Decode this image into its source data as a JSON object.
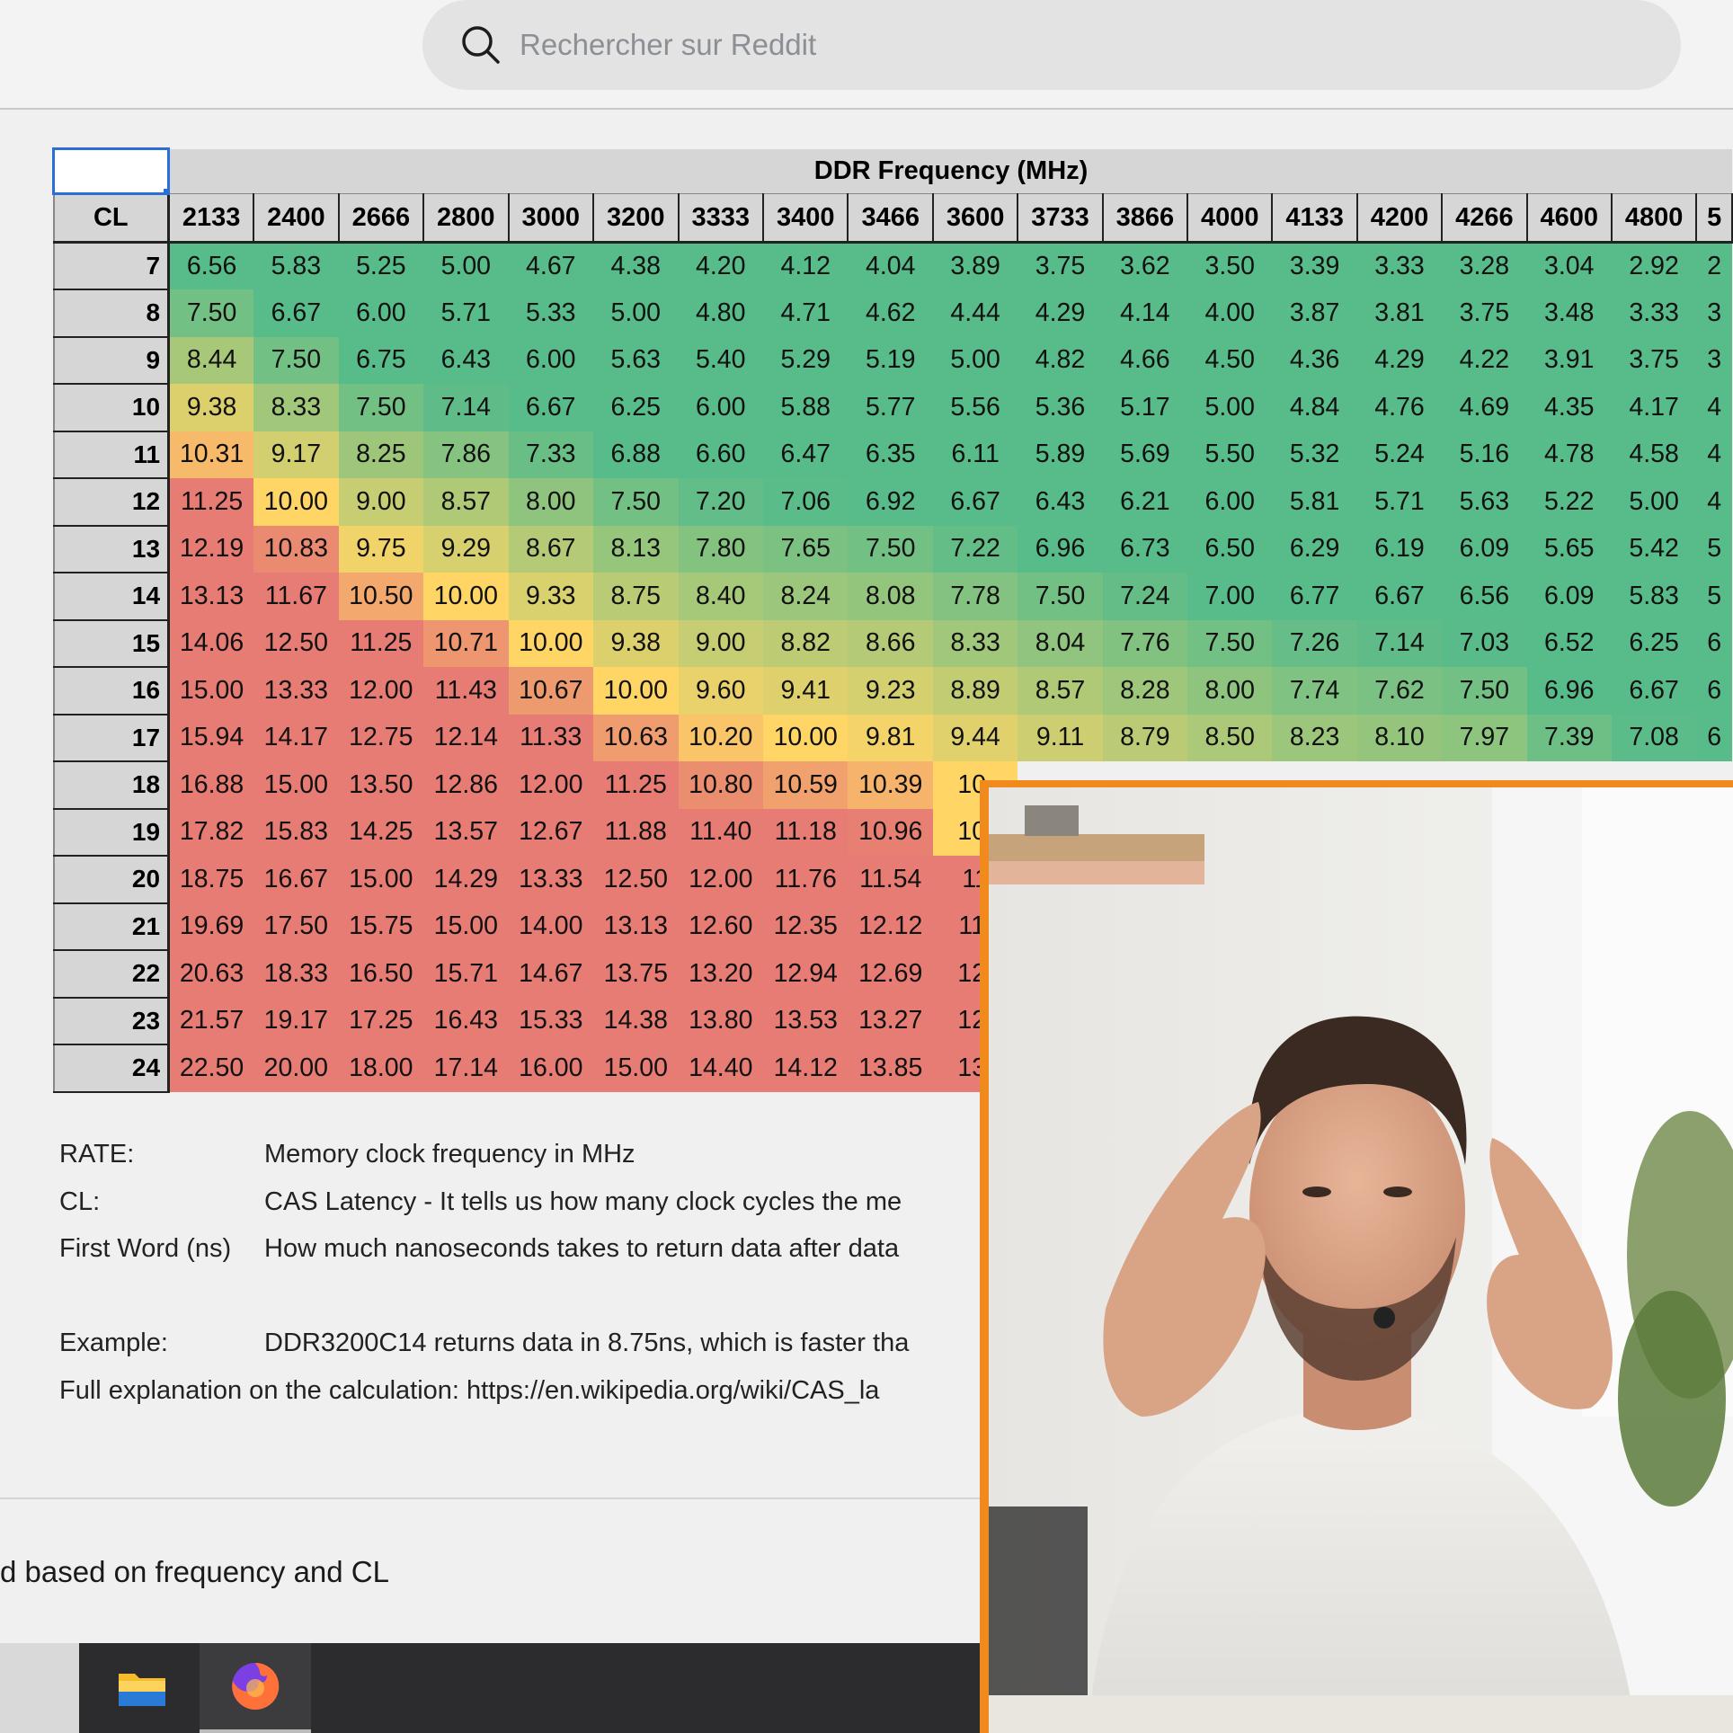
{
  "search": {
    "placeholder": "Rechercher sur Reddit"
  },
  "table": {
    "title": "DDR Frequency (MHz)",
    "cl_header": "CL",
    "frequencies": [
      "2133",
      "2400",
      "2666",
      "2800",
      "3000",
      "3200",
      "3333",
      "3400",
      "3466",
      "3600",
      "3733",
      "3866",
      "4000",
      "4133",
      "4200",
      "4266",
      "4600",
      "4800",
      "5"
    ],
    "rows": [
      {
        "cl": "7",
        "values": [
          "6.56",
          "5.83",
          "5.25",
          "5.00",
          "4.67",
          "4.38",
          "4.20",
          "4.12",
          "4.04",
          "3.89",
          "3.75",
          "3.62",
          "3.50",
          "3.39",
          "3.33",
          "3.28",
          "3.04",
          "2.92",
          "2"
        ]
      },
      {
        "cl": "8",
        "values": [
          "7.50",
          "6.67",
          "6.00",
          "5.71",
          "5.33",
          "5.00",
          "4.80",
          "4.71",
          "4.62",
          "4.44",
          "4.29",
          "4.14",
          "4.00",
          "3.87",
          "3.81",
          "3.75",
          "3.48",
          "3.33",
          "3"
        ]
      },
      {
        "cl": "9",
        "values": [
          "8.44",
          "7.50",
          "6.75",
          "6.43",
          "6.00",
          "5.63",
          "5.40",
          "5.29",
          "5.19",
          "5.00",
          "4.82",
          "4.66",
          "4.50",
          "4.36",
          "4.29",
          "4.22",
          "3.91",
          "3.75",
          "3"
        ]
      },
      {
        "cl": "10",
        "values": [
          "9.38",
          "8.33",
          "7.50",
          "7.14",
          "6.67",
          "6.25",
          "6.00",
          "5.88",
          "5.77",
          "5.56",
          "5.36",
          "5.17",
          "5.00",
          "4.84",
          "4.76",
          "4.69",
          "4.35",
          "4.17",
          "4"
        ]
      },
      {
        "cl": "11",
        "values": [
          "10.31",
          "9.17",
          "8.25",
          "7.86",
          "7.33",
          "6.88",
          "6.60",
          "6.47",
          "6.35",
          "6.11",
          "5.89",
          "5.69",
          "5.50",
          "5.32",
          "5.24",
          "5.16",
          "4.78",
          "4.58",
          "4"
        ]
      },
      {
        "cl": "12",
        "values": [
          "11.25",
          "10.00",
          "9.00",
          "8.57",
          "8.00",
          "7.50",
          "7.20",
          "7.06",
          "6.92",
          "6.67",
          "6.43",
          "6.21",
          "6.00",
          "5.81",
          "5.71",
          "5.63",
          "5.22",
          "5.00",
          "4"
        ]
      },
      {
        "cl": "13",
        "values": [
          "12.19",
          "10.83",
          "9.75",
          "9.29",
          "8.67",
          "8.13",
          "7.80",
          "7.65",
          "7.50",
          "7.22",
          "6.96",
          "6.73",
          "6.50",
          "6.29",
          "6.19",
          "6.09",
          "5.65",
          "5.42",
          "5"
        ]
      },
      {
        "cl": "14",
        "values": [
          "13.13",
          "11.67",
          "10.50",
          "10.00",
          "9.33",
          "8.75",
          "8.40",
          "8.24",
          "8.08",
          "7.78",
          "7.50",
          "7.24",
          "7.00",
          "6.77",
          "6.67",
          "6.56",
          "6.09",
          "5.83",
          "5"
        ]
      },
      {
        "cl": "15",
        "values": [
          "14.06",
          "12.50",
          "11.25",
          "10.71",
          "10.00",
          "9.38",
          "9.00",
          "8.82",
          "8.66",
          "8.33",
          "8.04",
          "7.76",
          "7.50",
          "7.26",
          "7.14",
          "7.03",
          "6.52",
          "6.25",
          "6"
        ]
      },
      {
        "cl": "16",
        "values": [
          "15.00",
          "13.33",
          "12.00",
          "11.43",
          "10.67",
          "10.00",
          "9.60",
          "9.41",
          "9.23",
          "8.89",
          "8.57",
          "8.28",
          "8.00",
          "7.74",
          "7.62",
          "7.50",
          "6.96",
          "6.67",
          "6"
        ]
      },
      {
        "cl": "17",
        "values": [
          "15.94",
          "14.17",
          "12.75",
          "12.14",
          "11.33",
          "10.63",
          "10.20",
          "10.00",
          "9.81",
          "9.44",
          "9.11",
          "8.79",
          "8.50",
          "8.23",
          "8.10",
          "7.97",
          "7.39",
          "7.08",
          "6"
        ]
      },
      {
        "cl": "18",
        "values": [
          "16.88",
          "15.00",
          "13.50",
          "12.86",
          "12.00",
          "11.25",
          "10.80",
          "10.59",
          "10.39",
          "10.",
          "",
          "",
          "",
          "",
          "",
          "",
          "",
          "",
          ""
        ]
      },
      {
        "cl": "19",
        "values": [
          "17.82",
          "15.83",
          "14.25",
          "13.57",
          "12.67",
          "11.88",
          "11.40",
          "11.18",
          "10.96",
          "10.",
          "",
          "",
          "",
          "",
          "",
          "",
          "",
          "",
          ""
        ]
      },
      {
        "cl": "20",
        "values": [
          "18.75",
          "16.67",
          "15.00",
          "14.29",
          "13.33",
          "12.50",
          "12.00",
          "11.76",
          "11.54",
          "11",
          "",
          "",
          "",
          "",
          "",
          "",
          "",
          "",
          ""
        ]
      },
      {
        "cl": "21",
        "values": [
          "19.69",
          "17.50",
          "15.75",
          "15.00",
          "14.00",
          "13.13",
          "12.60",
          "12.35",
          "12.12",
          "11.",
          "",
          "",
          "",
          "",
          "",
          "",
          "",
          "",
          ""
        ]
      },
      {
        "cl": "22",
        "values": [
          "20.63",
          "18.33",
          "16.50",
          "15.71",
          "14.67",
          "13.75",
          "13.20",
          "12.94",
          "12.69",
          "12.",
          "",
          "",
          "",
          "",
          "",
          "",
          "",
          "",
          ""
        ]
      },
      {
        "cl": "23",
        "values": [
          "21.57",
          "19.17",
          "17.25",
          "16.43",
          "15.33",
          "14.38",
          "13.80",
          "13.53",
          "13.27",
          "12.",
          "",
          "",
          "",
          "",
          "",
          "",
          "",
          "",
          ""
        ]
      },
      {
        "cl": "24",
        "values": [
          "22.50",
          "20.00",
          "18.00",
          "17.14",
          "16.00",
          "15.00",
          "14.40",
          "14.12",
          "13.85",
          "13.",
          "",
          "",
          "",
          "",
          "",
          "",
          "",
          "",
          ""
        ]
      }
    ]
  },
  "legend": [
    {
      "key": "RATE:",
      "value": "Memory clock frequency in MHz"
    },
    {
      "key": "CL:",
      "value": "CAS Latency - It tells us how many clock cycles the me"
    },
    {
      "key": "First Word (ns)",
      "value": "How much nanoseconds takes to return data after data"
    },
    {
      "key": "",
      "value": ""
    },
    {
      "key": "Example:",
      "value": "DDR3200C14 returns data in 8.75ns, which is faster tha"
    },
    {
      "key": "Full explanation on the calculation: https://en.wikipedia.org/wiki/CAS_la",
      "value": ""
    }
  ],
  "post": {
    "title_fragment": "d based on frequency and CL"
  },
  "colors": {
    "heat_good": "#57bb8a",
    "heat_mid": "#ffd666",
    "heat_bad": "#e67c73",
    "cam_border": "#f08a1c"
  },
  "taskbar": {
    "icons": [
      "folder-icon",
      "firefox-icon"
    ]
  }
}
